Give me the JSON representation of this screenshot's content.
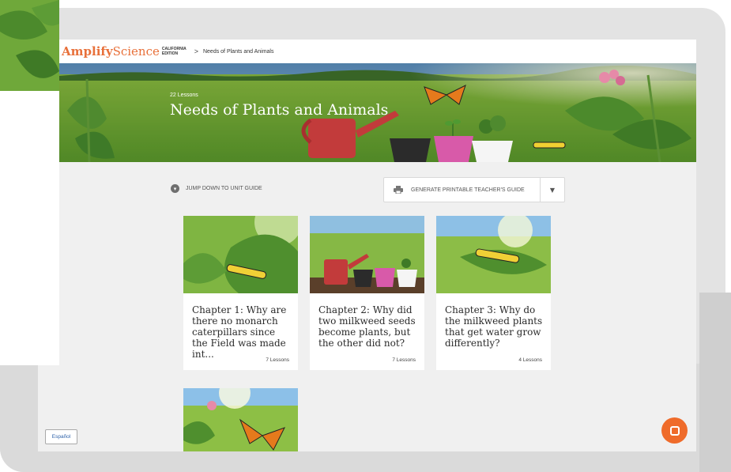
{
  "brand": {
    "name_strong": "Amplify",
    "name_light": "Science",
    "edition_line1": "CALIFORNIA",
    "edition_line2": "EDITION",
    "color": "#e8703a"
  },
  "breadcrumb": {
    "separator": ">",
    "current": "Needs of Plants and Animals"
  },
  "hero": {
    "lesson_count": "22 Lessons",
    "title": "Needs of Plants and Animals"
  },
  "toolbar": {
    "jump_label": "JUMP DOWN TO UNIT GUIDE",
    "jump_icon": "chevron-down-circle-icon",
    "generate_label": "GENERATE PRINTABLE TEACHER'S GUIDE",
    "generate_icon": "printer-icon",
    "caret": "▼"
  },
  "chapters": [
    {
      "title": "Chapter 1: Why are there no monarch caterpillars since the Field was made int...",
      "lessons": "7 Lessons"
    },
    {
      "title": "Chapter 2: Why did two milkweed seeds become plants, but the other did not?",
      "lessons": "7 Lessons"
    },
    {
      "title": "Chapter 3: Why do the milkweed plants that get water grow differently?",
      "lessons": "4 Lessons"
    }
  ],
  "footer": {
    "language_button": "Español",
    "chat_icon": "chat-icon",
    "chat_color": "#ef6b2a"
  }
}
